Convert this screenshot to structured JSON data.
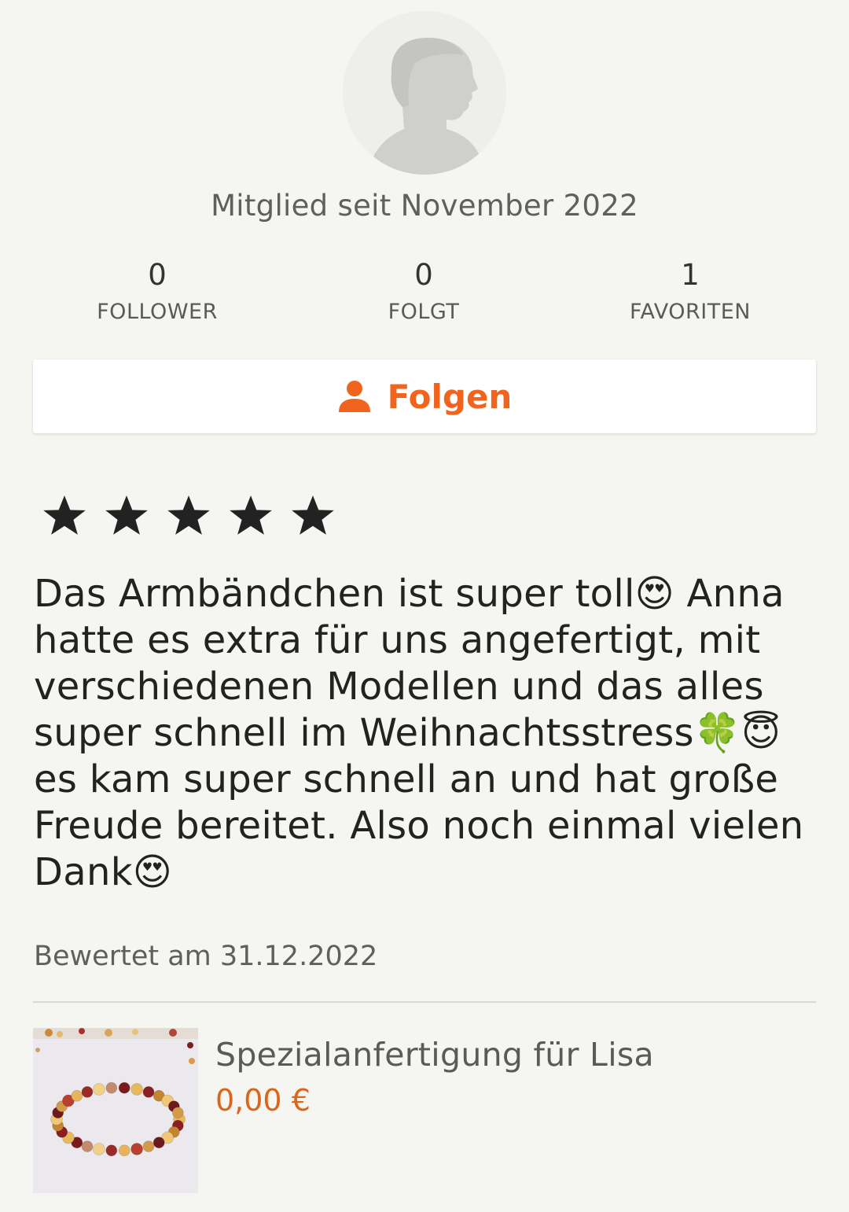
{
  "profile": {
    "member_since": "Mitglied seit November 2022"
  },
  "stats": [
    {
      "value": "0",
      "label": "FOLLOWER"
    },
    {
      "value": "0",
      "label": "FOLGT"
    },
    {
      "value": "1",
      "label": "FAVORITEN"
    }
  ],
  "follow_button": {
    "label": "Folgen",
    "icon": "person-icon"
  },
  "review": {
    "rating": 5,
    "rating_max": 5,
    "text": "Das Armbändchen ist super toll😍 Anna hatte es extra für uns angefertigt, mit verschiedenen Modellen und das alles super schnell im Weihnachtsstress🍀😇 es kam super schnell an und hat große Freude bereitet. Also noch einmal vielen Dank😍",
    "date": "Bewertet am 31.12.2022"
  },
  "product": {
    "title": "Spezialanfertigung für Lisa",
    "price": "0,00 €"
  },
  "colors": {
    "accent": "#f1641e",
    "price": "#d9661c",
    "background": "#f5f5f1"
  }
}
